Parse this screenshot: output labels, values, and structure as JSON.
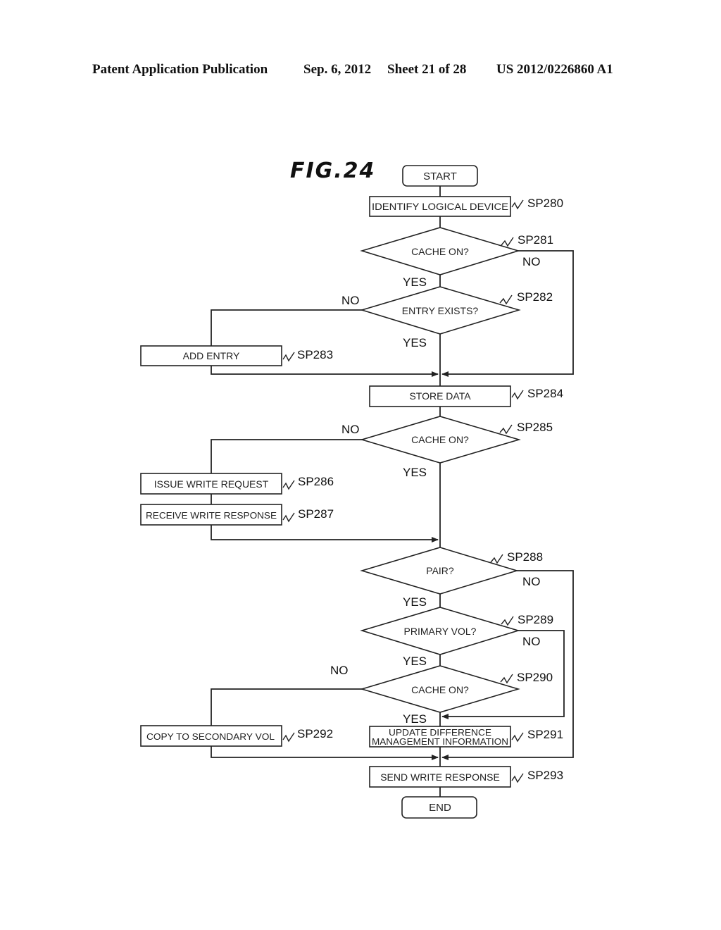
{
  "header": {
    "publication": "Patent Application Publication",
    "date": "Sep. 6, 2012",
    "sheet": "Sheet 21 of 28",
    "patent_number": "US 2012/0226860 A1"
  },
  "figure": {
    "title": "FIG.24"
  },
  "flowchart": {
    "start": "START",
    "end": "END",
    "steps": {
      "sp280": {
        "label": "IDENTIFY LOGICAL DEVICE",
        "id": "SP280"
      },
      "sp281": {
        "label": "CACHE ON?",
        "id": "SP281"
      },
      "sp282": {
        "label": "ENTRY EXISTS?",
        "id": "SP282"
      },
      "sp283": {
        "label": "ADD ENTRY",
        "id": "SP283"
      },
      "sp284": {
        "label": "STORE DATA",
        "id": "SP284"
      },
      "sp285": {
        "label": "CACHE ON?",
        "id": "SP285"
      },
      "sp286": {
        "label": "ISSUE WRITE REQUEST",
        "id": "SP286"
      },
      "sp287": {
        "label": "RECEIVE WRITE RESPONSE",
        "id": "SP287"
      },
      "sp288": {
        "label": "PAIR?",
        "id": "SP288"
      },
      "sp289": {
        "label": "PRIMARY VOL?",
        "id": "SP289"
      },
      "sp290": {
        "label": "CACHE ON?",
        "id": "SP290"
      },
      "sp291": {
        "label_line1": "UPDATE DIFFERENCE",
        "label_line2": "MANAGEMENT INFORMATION",
        "id": "SP291"
      },
      "sp292": {
        "label": "COPY TO SECONDARY VOL",
        "id": "SP292"
      },
      "sp293": {
        "label": "SEND WRITE RESPONSE",
        "id": "SP293"
      }
    },
    "branches": {
      "yes": "YES",
      "no": "NO"
    }
  }
}
